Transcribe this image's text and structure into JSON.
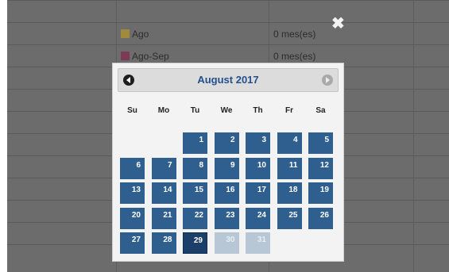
{
  "background_table": {
    "rows": [
      {
        "label": "Ago",
        "value": "0 mes(es)",
        "swatch_color": "#a08a3b"
      },
      {
        "label": "Ago-Sep",
        "value": "0 mes(es)",
        "swatch_color": "#7e3a55"
      }
    ],
    "close_symbol": "✖"
  },
  "datepicker": {
    "title": "August 2017",
    "prev_icon": "circle-left-arrow-icon",
    "next_icon": "circle-right-arrow-icon",
    "weekdays": [
      "Su",
      "Mo",
      "Tu",
      "We",
      "Th",
      "Fr",
      "Sa"
    ],
    "weeks": [
      [
        null,
        null,
        "1",
        "2",
        "3",
        "4",
        "5"
      ],
      [
        "6",
        "7",
        "8",
        "9",
        "10",
        "11",
        "12"
      ],
      [
        "13",
        "14",
        "15",
        "16",
        "17",
        "18",
        "19"
      ],
      [
        "20",
        "21",
        "22",
        "23",
        "24",
        "25",
        "26"
      ],
      [
        "27",
        "28",
        "29",
        "30",
        "31",
        null,
        null
      ]
    ],
    "today": "29",
    "disabled_days": [
      "30",
      "31"
    ],
    "colors": {
      "day_bg": "#2f5f8f",
      "today_bg": "#1b3f69",
      "disabled_bg": "#b8c7d6",
      "title": "#254f8b"
    }
  }
}
